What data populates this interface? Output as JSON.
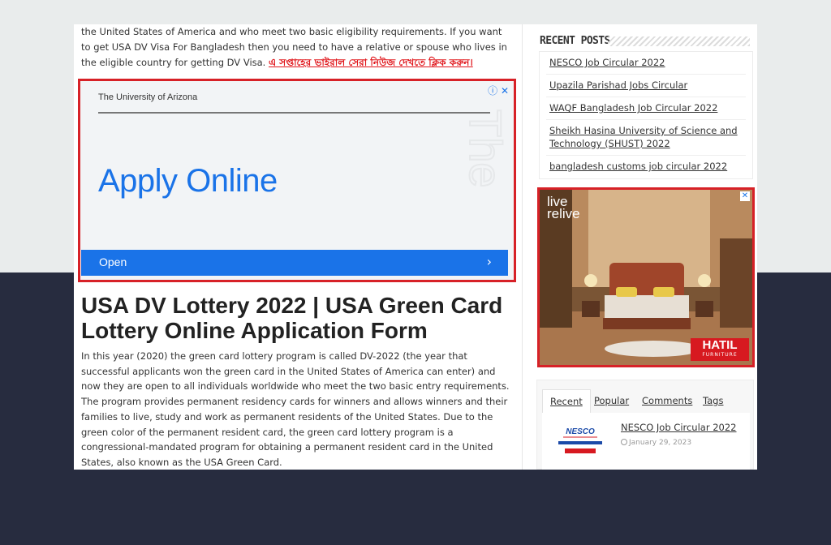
{
  "article": {
    "intro": "the United States of America and who meet two basic eligibility requirements. If you want to get USA DV Visa For Bangladesh then you need to have a relative or spouse who lives in the eligible country for getting DV Visa.",
    "bengali_link": "এ সপ্তাহের ভাইরাল সেরা নিউজ দেখতে ক্লিক করুন।",
    "title": "USA DV Lottery 2022 | USA Green Card Lottery Online Application Form",
    "body": "In this year (2020) the green card lottery program is called DV-2022 (the year that successful applicants won the green card in the United States of America can enter) and now they are open to all individuals worldwide who meet the two basic entry requirements. The program provides permanent residency cards for winners and allows winners and their families to live, study and work as permanent residents of the United States. Due to the green color of the permanent resident card, the green card lottery program is a congressional-mandated program for obtaining a permanent resident card in the United States, also known as the USA Green Card."
  },
  "ad_top": {
    "advertiser": "The University of Arizona",
    "headline": "Apply Online",
    "cta": "Open",
    "deco_text": "The",
    "colors": {
      "accent": "#1a73e8",
      "border": "#d72127"
    }
  },
  "sidebar": {
    "recent_posts_title": "RECENT POSTS",
    "recent_posts": [
      "NESCO Job Circular 2022",
      "Upazila Parishad Jobs Circular",
      "WAQF Bangladesh Job Circular 2022",
      "Sheikh Hasina University of Science and Technology (SHUST) 2022",
      "bangladesh customs job circular 2022"
    ],
    "ad_side": {
      "logo_line1": "live",
      "logo_line2": "relive",
      "brand": "HATIL",
      "brand_sub": "FURNITURE"
    },
    "tabs": [
      "Recent",
      "Popular",
      "Comments",
      "Tags"
    ],
    "active_tab": "Recent",
    "tab_post": {
      "title": "NESCO Job Circular 2022",
      "date": "January 29, 2023",
      "thumb_logo": "NESCO"
    }
  },
  "icons": {
    "adchoices": "info-icon",
    "ad_close": "close-icon",
    "cta_arrow": "chevron-right-icon",
    "date": "clock-icon"
  }
}
